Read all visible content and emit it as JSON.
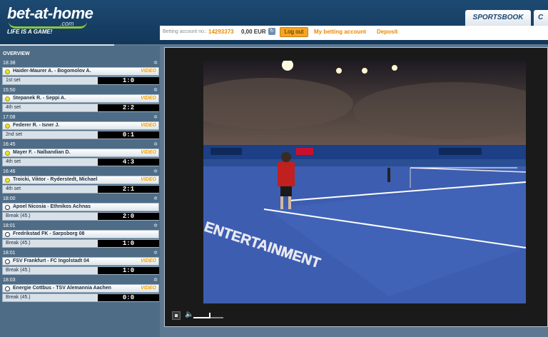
{
  "header": {
    "logo_text": "bet-at-home",
    "logo_suffix": ".com",
    "slogan": "LIFE IS A GAME!",
    "tab_active": "SPORTSBOOK",
    "tab_next": "C"
  },
  "account": {
    "label": "Betting account no.:",
    "number": "14293373",
    "balance": "0,00 EUR",
    "logout": "Log out",
    "my_account": "My betting account",
    "deposit": "Deposit"
  },
  "overview": {
    "title": "OVERVIEW",
    "video_label": "VIDEO",
    "star": "✲",
    "matches": [
      {
        "time": "18:38",
        "name": "Haider-Maurer A. - Bogomolov A.",
        "status": "1st set",
        "score": "1:0",
        "sport": "tennis",
        "video": true
      },
      {
        "time": "15:50",
        "name": "Stepanek R. - Seppi A.",
        "status": "4th set",
        "score": "2:2",
        "sport": "tennis",
        "video": true
      },
      {
        "time": "17:08",
        "name": "Federer R. - Isner J.",
        "status": "2nd set",
        "score": "0:1",
        "sport": "tennis",
        "video": true
      },
      {
        "time": "16:45",
        "name": "Mayer F. - Nalbandian D.",
        "status": "4th set",
        "score": "4:3",
        "sport": "tennis",
        "video": true
      },
      {
        "time": "16:46",
        "name": "Troicki, Viktor - Ryderstedt, Michael",
        "status": "4th set",
        "score": "2:1",
        "sport": "tennis",
        "video": true
      },
      {
        "time": "18:00",
        "name": "Apoel Nicosia - Ethnikos Achnas",
        "status": "Break (45.)",
        "score": "2:0",
        "sport": "soccer",
        "video": false
      },
      {
        "time": "18:01",
        "name": "Fredrikstad FK - Sarpsborg 08",
        "status": "Break (45.)",
        "score": "1:0",
        "sport": "soccer",
        "video": false
      },
      {
        "time": "18:01",
        "name": "FSV Frankfurt - FC Ingolstadt 04",
        "status": "Break (45.)",
        "score": "1:0",
        "sport": "soccer",
        "video": true
      },
      {
        "time": "18:03",
        "name": "Energie Cottbus - TSV Alemannia Aachen",
        "status": "Break (45.)",
        "score": "0:0",
        "sport": "soccer",
        "video": true
      }
    ]
  },
  "video": {
    "court_text": "ENTERTAINMENT",
    "volume": 0.55
  }
}
